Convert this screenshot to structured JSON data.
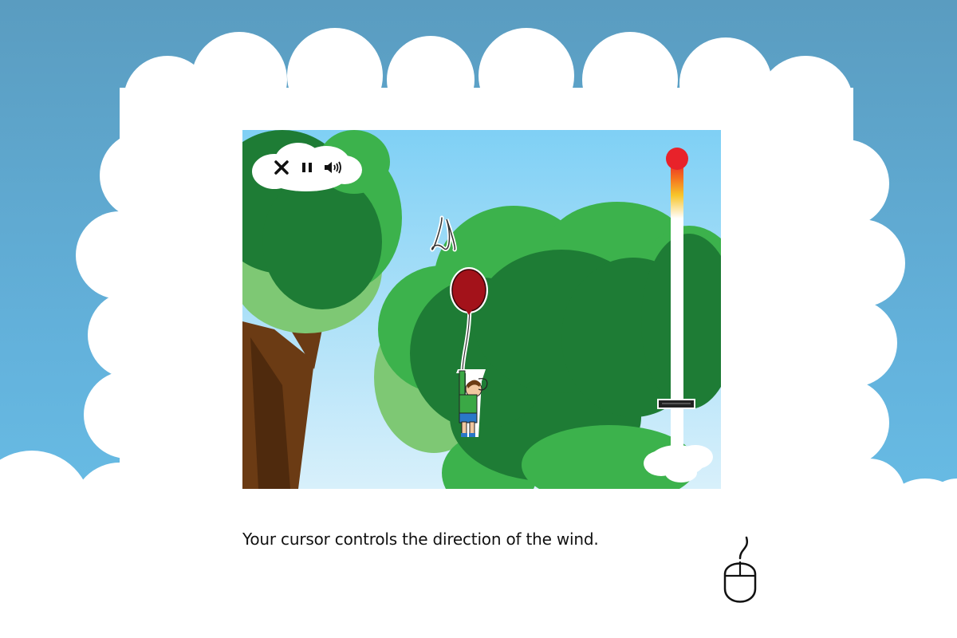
{
  "controls": {
    "close_icon": "close-icon",
    "pause_icon": "pause-icon",
    "sound_icon": "speaker-icon"
  },
  "instruction": {
    "text": "Your cursor controls the direction of the wind."
  },
  "wind_meter": {
    "level": 0.2,
    "gradient": [
      "#e8222a",
      "#f5701e",
      "#f7c52a",
      "#ffffff"
    ]
  },
  "colors": {
    "sky_top": "#7fd0f5",
    "sky_bottom": "#d8f0fb",
    "tree_dark": "#1e7c35",
    "tree_mid": "#3cb24c",
    "tree_light": "#7ec874",
    "trunk": "#6b3b14",
    "balloon": "#a3121a",
    "shirt": "#3aa845",
    "shorts": "#2a78c8",
    "page_background": "#5fa9d3"
  }
}
